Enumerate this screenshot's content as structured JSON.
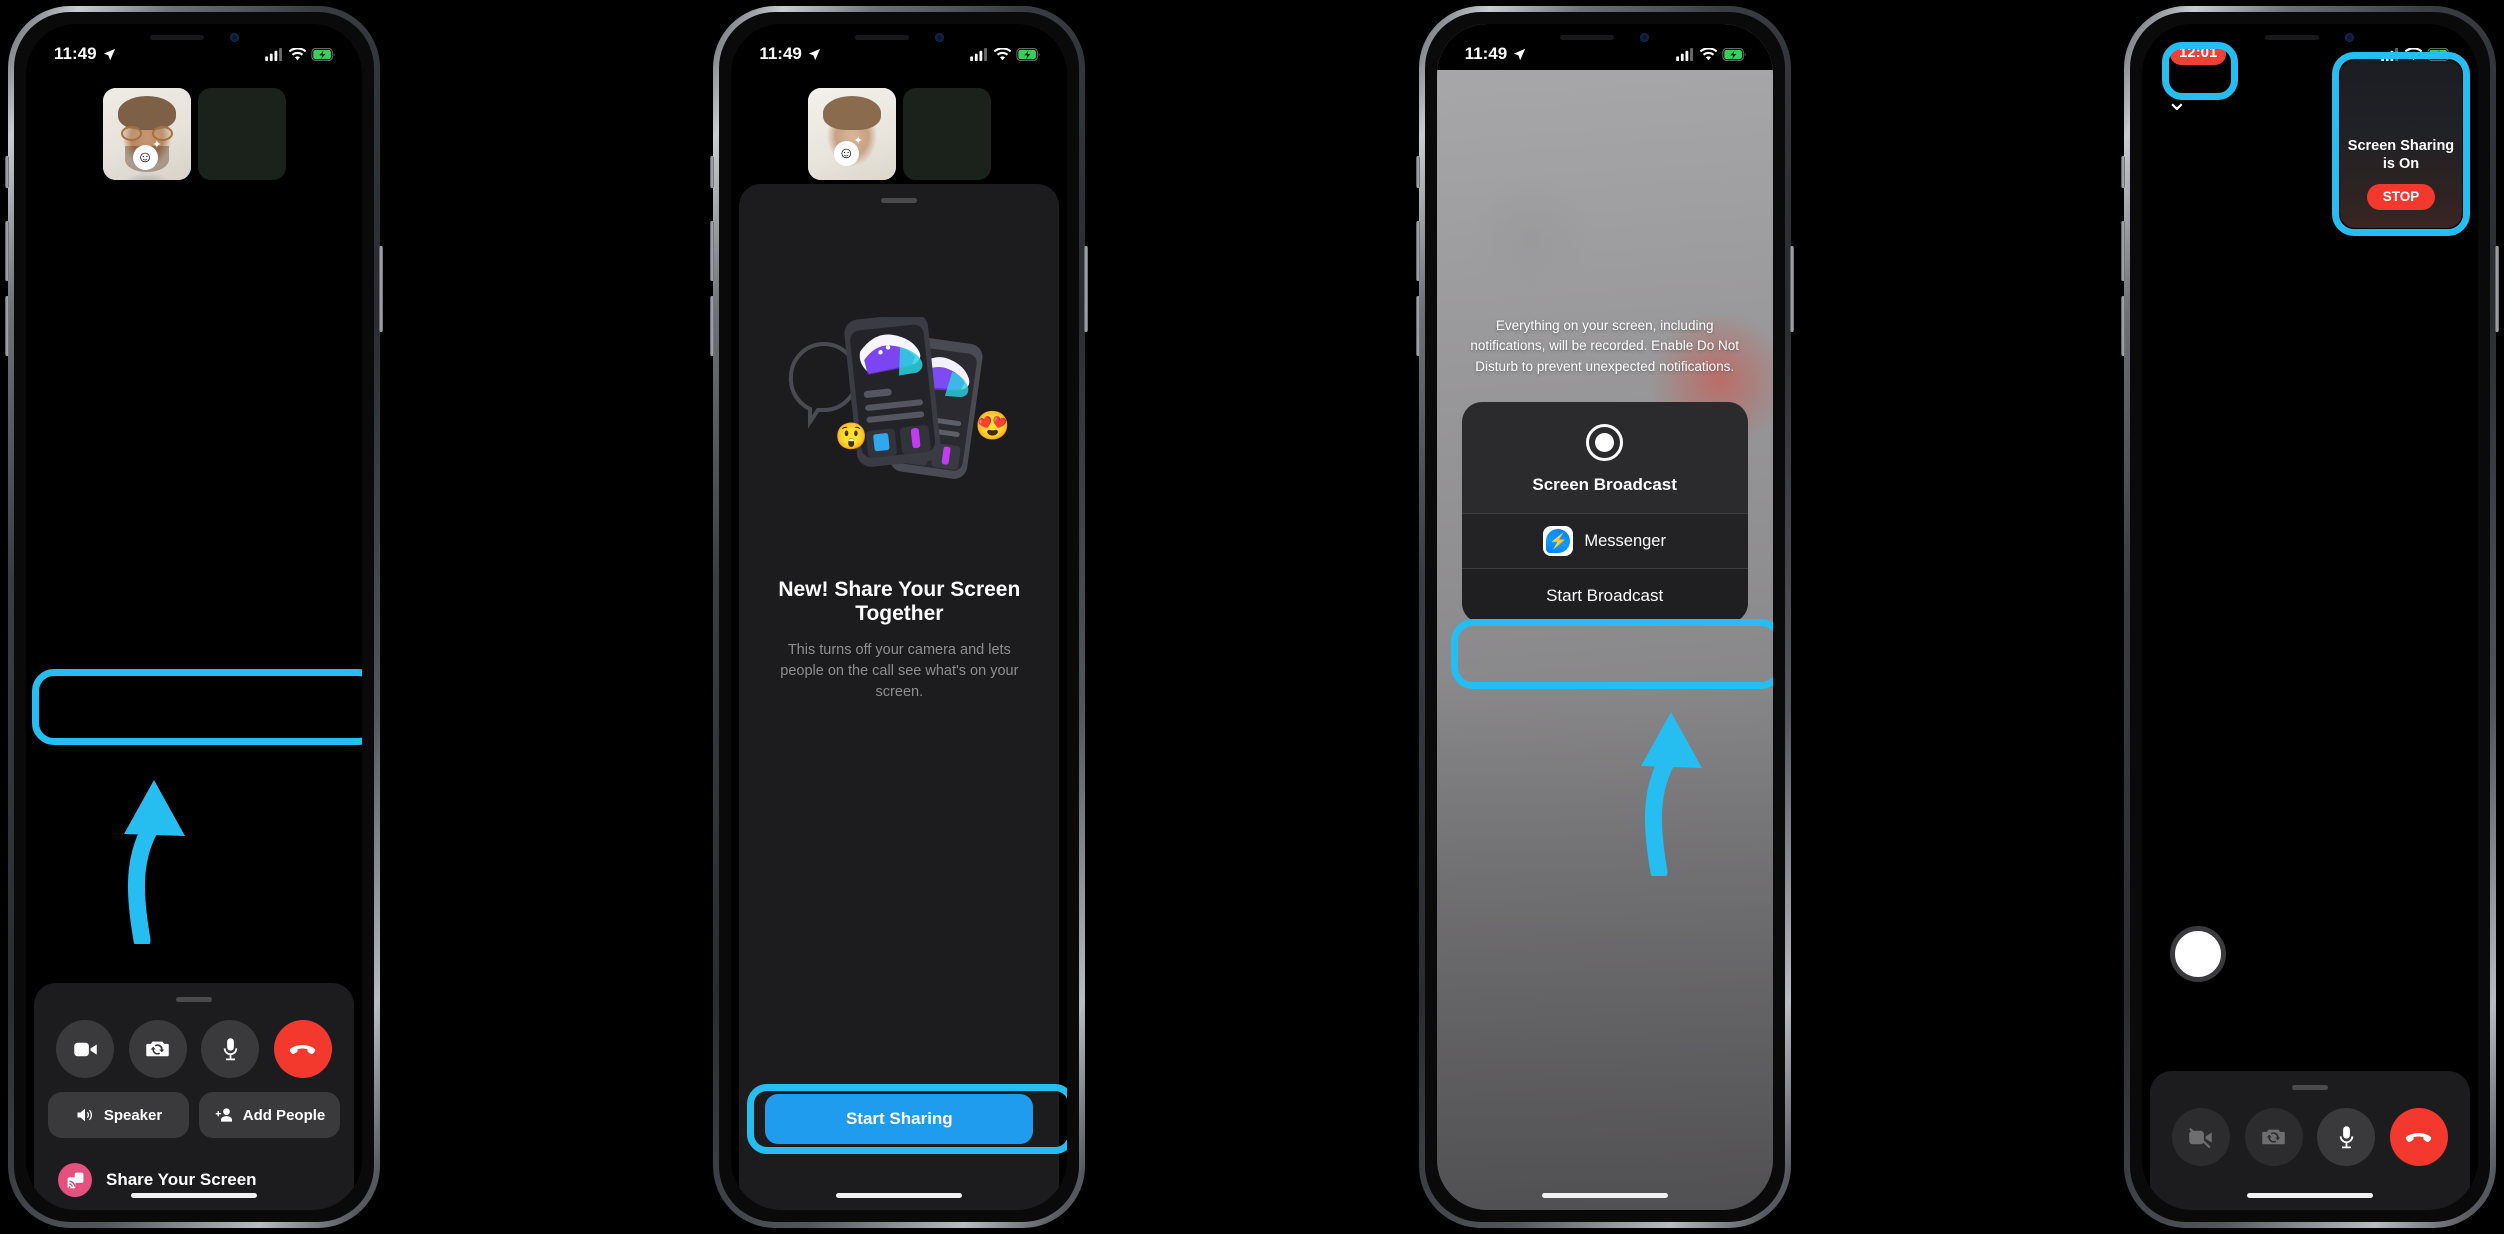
{
  "screens": [
    {
      "id": "call-controls",
      "statusbar": {
        "time": "11:49",
        "location_icon": "location-arrow-icon",
        "cellular_icon": "cellular-bars-icon",
        "wifi_icon": "wifi-icon",
        "battery_icon": "battery-charging-icon"
      },
      "controls": [
        {
          "name": "video-toggle",
          "icon": "video-camera-icon",
          "state": "on"
        },
        {
          "name": "camera-flip",
          "icon": "camera-flip-icon",
          "state": "on"
        },
        {
          "name": "mic-toggle",
          "icon": "microphone-icon",
          "state": "on"
        },
        {
          "name": "end-call",
          "icon": "hangup-phone-icon",
          "state": "danger"
        }
      ],
      "pills": [
        {
          "label": "Speaker",
          "icon": "speaker-icon"
        },
        {
          "label": "Add People",
          "icon": "add-person-icon"
        }
      ],
      "share_row": {
        "label": "Share Your Screen",
        "icon": "screen-cast-icon",
        "icon_color": "#e5507f",
        "highlighted": true
      }
    },
    {
      "id": "share-intro",
      "statusbar": {
        "time": "11:49"
      },
      "title": "New! Share Your Screen Together",
      "subtitle": "This turns off your camera and lets people on the call see what's on your screen.",
      "primary_button": {
        "label": "Start Sharing",
        "color": "#1f9ced",
        "highlighted": true
      },
      "illustration": {
        "name": "phones-shopping-illustration",
        "emojis": [
          "😲",
          "😍"
        ]
      }
    },
    {
      "id": "broadcast-sheet",
      "statusbar": {
        "time": "11:49"
      },
      "permission_text": "Everything on your screen, including notifications, will be recorded. Enable Do Not Disturb to prevent unexpected notifications.",
      "card_title": "Screen Broadcast",
      "card_icon": "record-dot-icon",
      "app_row": {
        "label": "Messenger",
        "icon": "messenger-icon"
      },
      "start_button": {
        "label": "Start Broadcast",
        "highlighted": true
      }
    },
    {
      "id": "sharing-active",
      "statusbar": {
        "time": "12:01",
        "time_badge_color": "#ef4136",
        "highlighted": true
      },
      "collapse_icon": "chevron-down-icon",
      "sharing_card": {
        "title": "Screen Sharing is On",
        "button_label": "STOP",
        "button_color": "#f3392e",
        "highlighted": true
      },
      "controls": [
        {
          "name": "video-toggle",
          "icon": "video-camera-off-icon",
          "state": "off"
        },
        {
          "name": "camera-flip",
          "icon": "camera-flip-icon",
          "state": "disabled"
        },
        {
          "name": "mic-toggle",
          "icon": "microphone-icon",
          "state": "on"
        },
        {
          "name": "end-call",
          "icon": "hangup-phone-icon",
          "state": "danger"
        }
      ]
    }
  ],
  "annotation": {
    "highlight_color": "#26bdf0",
    "arrow_color": "#26bdf0"
  }
}
